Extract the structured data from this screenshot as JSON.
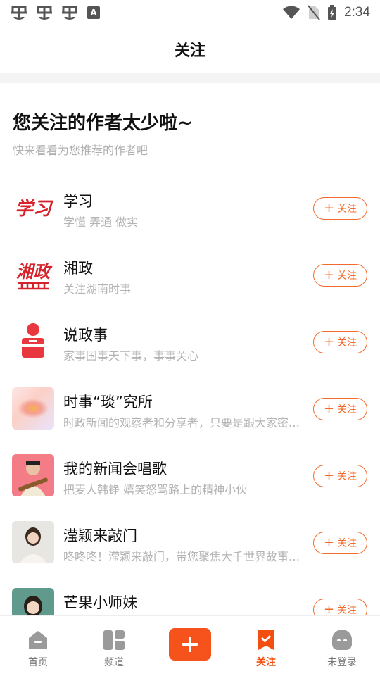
{
  "status_bar": {
    "time": "2:34",
    "icons": [
      "bug-icon",
      "bug-icon",
      "bug-icon",
      "a-icon",
      "wifi-icon",
      "no-sim-icon",
      "battery-charging-icon"
    ],
    "a_label": "A"
  },
  "header": {
    "title": "关注"
  },
  "intro": {
    "headline": "您关注的作者太少啦~",
    "subline": "快来看看为您推荐的作者吧"
  },
  "follow_label": "关注",
  "follow_color": "#f36b2c",
  "authors": [
    {
      "name": "学习",
      "desc": "学懂 弄通 做实",
      "avatar": "xuexi-logo",
      "logo_text": "学习"
    },
    {
      "name": "湘政",
      "desc": "关注湖南时事",
      "avatar": "xiangzheng-logo",
      "logo_text": "湘政"
    },
    {
      "name": "说政事",
      "desc": "家事国事天下事，事事关心",
      "avatar": "speaker-podium-icon"
    },
    {
      "name": "时事“琰”究所",
      "desc": "时政新闻的观察者和分享者，只要是跟大家密切相关的",
      "avatar": "blurred-gradient-image"
    },
    {
      "name": "我的新闻会唱歌",
      "desc": "把麦人韩铮 嬉笑怒骂路上的精神小伙",
      "avatar": "man-with-guitar-photo"
    },
    {
      "name": "滢颖来敲门",
      "desc": "咚咚咚！滢颖来敲门，带您聚焦大千世界故事，关注热点",
      "avatar": "woman-portrait-photo"
    },
    {
      "name": "芒果小师妹",
      "desc": "",
      "avatar": "woman-portrait-photo"
    }
  ],
  "bottom_nav": {
    "items": [
      {
        "label": "首页",
        "icon": "home-icon"
      },
      {
        "label": "频道",
        "icon": "channel-grid-icon"
      },
      {
        "label": "",
        "icon": "plus-icon"
      },
      {
        "label": "关注",
        "icon": "bookmark-check-icon"
      },
      {
        "label": "未登录",
        "icon": "user-avatar-icon"
      }
    ],
    "active_color": "#f24f10",
    "publish_color": "#f5521c"
  }
}
